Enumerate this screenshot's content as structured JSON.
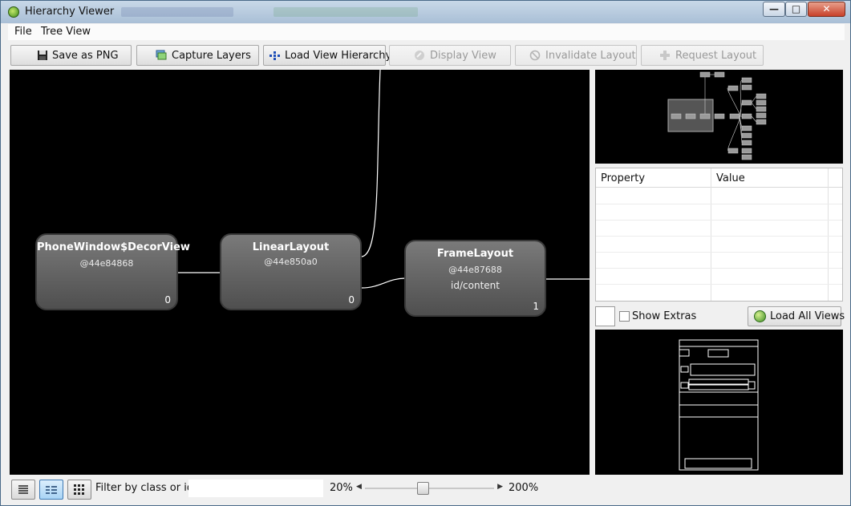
{
  "window": {
    "title": "Hierarchy Viewer",
    "min_glyph": "—",
    "max_glyph": "□",
    "close_glyph": "✕"
  },
  "menu": {
    "items": [
      {
        "label": "File"
      },
      {
        "label": "Tree View"
      }
    ]
  },
  "toolbar": {
    "save_png": "Save as PNG",
    "capture_layers": "Capture Layers",
    "load_view_hierarchy": "Load View Hierarchy",
    "display_view": "Display View",
    "invalidate_layout": "Invalidate Layout",
    "request_layout": "Request Layout"
  },
  "tree": {
    "nodes": [
      {
        "name": "PhoneWindow$DecorView",
        "id": "@44e84868",
        "resource": "",
        "children": "0"
      },
      {
        "name": "LinearLayout",
        "id": "@44e850a0",
        "resource": "",
        "children": "0"
      },
      {
        "name": "FrameLayout",
        "id": "@44e87688",
        "resource": "id/content",
        "children": "1"
      }
    ]
  },
  "properties": {
    "col_property": "Property",
    "col_value": "Value"
  },
  "extras": {
    "show_extras": "Show Extras",
    "show_extras_checked": false,
    "load_all_views": "Load All Views"
  },
  "statusbar": {
    "filter_label": "Filter by class or id:",
    "filter_value": "",
    "zoom_min": "20%",
    "zoom_max": "200%",
    "zoom_level": 0.444
  },
  "colors": {
    "canvas_bg": "#000000",
    "node_fill": "#6a6a6a",
    "edge": "#ffffff",
    "active_toggle": "#a9d4f5"
  }
}
